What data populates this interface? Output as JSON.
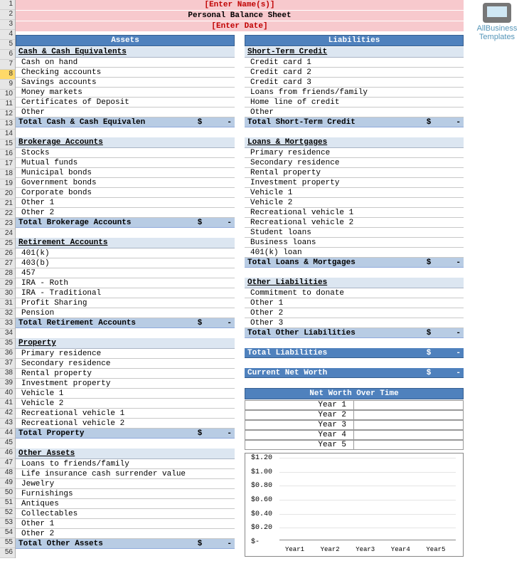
{
  "header": {
    "enter_names": "[Enter Name(s)]",
    "title": "Personal Balance Sheet",
    "enter_date": "[Enter Date]"
  },
  "watermark": {
    "line1": "AllBusiness",
    "line2": "Templates"
  },
  "assets": {
    "section_title": "Assets",
    "cash": {
      "title": "Cash & Cash Equivalents",
      "items": [
        "Cash on hand",
        "Checking accounts",
        "Savings accounts",
        "Money markets",
        "Certificates of Deposit",
        "Other"
      ],
      "total_label": "Total Cash & Cash Equivalen",
      "total_cur": "$",
      "total_val": "-"
    },
    "brokerage": {
      "title": "Brokerage Accounts",
      "items": [
        "Stocks",
        "Mutual funds",
        "Municipal bonds",
        "Government bonds",
        "Corporate bonds",
        "Other 1",
        "Other 2"
      ],
      "total_label": "Total Brokerage Accounts",
      "total_cur": "$",
      "total_val": "-"
    },
    "retirement": {
      "title": "Retirement Accounts",
      "items": [
        "401(k)",
        "403(b)",
        "457",
        "IRA - Roth",
        "IRA - Traditional",
        "Profit Sharing",
        "Pension"
      ],
      "total_label": "Total Retirement Accounts",
      "total_cur": "$",
      "total_val": "-"
    },
    "property": {
      "title": "Property",
      "items": [
        "Primary  residence",
        "Secondary residence",
        "Rental property",
        "Investment property",
        "Vehicle 1",
        "Vehicle 2",
        "Recreational vehicle 1",
        "Recreational vehicle 2"
      ],
      "total_label": "Total Property",
      "total_cur": "$",
      "total_val": "-"
    },
    "other": {
      "title": "Other Assets",
      "items": [
        "Loans to friends/family",
        "Life insurance cash surrender value",
        "Jewelry",
        "Furnishings",
        "Antiques",
        "Collectables",
        "Other 1",
        "Other 2"
      ],
      "total_label": "Total Other Assets",
      "total_cur": "$",
      "total_val": "-"
    }
  },
  "liabilities": {
    "section_title": "Liabilities",
    "short_credit": {
      "title": "Short-Term Credit",
      "items": [
        "Credit card 1",
        "Credit card 2",
        "Credit card 3",
        "Loans from friends/family",
        "Home line of credit",
        "Other"
      ],
      "total_label": "Total Short-Term Credit",
      "total_cur": "$",
      "total_val": "-"
    },
    "loans": {
      "title": "Loans & Mortgages",
      "items": [
        "Primary  residence",
        "Secondary residence",
        "Rental property",
        "Investment property",
        "Vehicle 1",
        "Vehicle 2",
        "Recreational vehicle 1",
        "Recreational vehicle 2",
        "Student loans",
        "Business loans",
        "401(k) loan"
      ],
      "total_label": "Total Loans & Mortgages",
      "total_cur": "$",
      "total_val": "-"
    },
    "other_liab": {
      "title": "Other Liabilities",
      "items": [
        "Commitment to donate",
        "Other 1",
        "Other 2",
        "Other 3"
      ],
      "total_label": "Total Other Liabilities",
      "total_cur": "$",
      "total_val": "-"
    },
    "total_liab": {
      "label": "Total Liabilities",
      "cur": "$",
      "val": "-"
    }
  },
  "net_worth": {
    "current_label": "Current Net Worth",
    "current_cur": "$",
    "current_val": "-",
    "over_time_title": "Net Worth Over Time",
    "years": [
      "Year 1",
      "Year 2",
      "Year 3",
      "Year 4",
      "Year 5"
    ]
  },
  "chart_data": {
    "type": "bar",
    "categories": [
      "Year1",
      "Year2",
      "Year3",
      "Year4",
      "Year5"
    ],
    "values": [
      0,
      0,
      0,
      0,
      0
    ],
    "yticks": [
      "$1.20",
      "$1.00",
      "$0.80",
      "$0.60",
      "$0.40",
      "$0.20",
      "$-"
    ],
    "ylim": [
      0,
      1.2
    ],
    "title": "",
    "xlabel": "",
    "ylabel": ""
  },
  "row_numbers": {
    "start": 1,
    "end": 56,
    "selected": 8
  }
}
